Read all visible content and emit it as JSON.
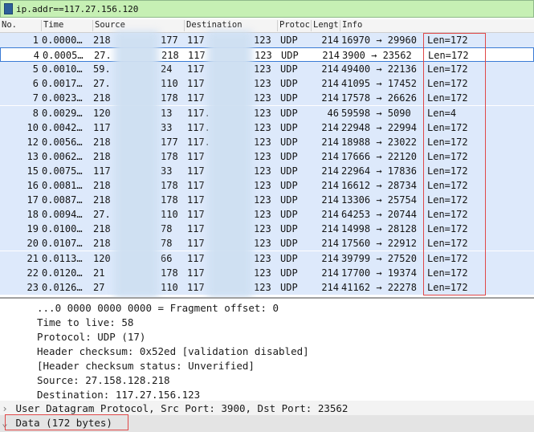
{
  "filter": {
    "text": "ip.addr==117.27.156.120"
  },
  "columns": [
    "No.",
    "Time",
    "Source",
    "Destination",
    "Protoc",
    "Lengt",
    "Info"
  ],
  "rows": [
    {
      "no": "1",
      "time": "0.0000…",
      "src_a": "218",
      "src_b": "177",
      "dst_a": "117",
      "dst_b": "123",
      "proto": "UDP",
      "len": "214",
      "info": "16970 → 29960",
      "lenval": "Len=172"
    },
    {
      "no": "4",
      "time": "0.0005…",
      "src_a": "27.",
      "src_b": "218",
      "dst_a": "117",
      "dst_b": "123",
      "proto": "UDP",
      "len": "214",
      "info": "3900 → 23562",
      "lenval": "Len=172"
    },
    {
      "no": "5",
      "time": "0.0010…",
      "src_a": "59.",
      "src_b": "24",
      "dst_a": "117",
      "dst_b": "123",
      "proto": "UDP",
      "len": "214",
      "info": "49400 → 22136",
      "lenval": "Len=172"
    },
    {
      "no": "6",
      "time": "0.0017…",
      "src_a": "27.",
      "src_b": "110",
      "dst_a": "117",
      "dst_b": "123",
      "proto": "UDP",
      "len": "214",
      "info": "41095 → 17452",
      "lenval": "Len=172"
    },
    {
      "no": "7",
      "time": "0.0023…",
      "src_a": "218",
      "src_b": "178",
      "dst_a": "117",
      "dst_b": "123",
      "proto": "UDP",
      "len": "214",
      "info": "17578 → 26626",
      "lenval": "Len=172"
    },
    {
      "no": "8",
      "time": "0.0029…",
      "src_a": "120",
      "src_b": "13",
      "dst_a": "117.",
      "dst_b": "123",
      "proto": "UDP",
      "len": "46",
      "info": "59598 → 5090",
      "lenval": "Len=4"
    },
    {
      "no": "10",
      "time": "0.0042…",
      "src_a": "117",
      "src_b": "33",
      "dst_a": "117.",
      "dst_b": "123",
      "proto": "UDP",
      "len": "214",
      "info": "22948 → 22994",
      "lenval": "Len=172"
    },
    {
      "no": "12",
      "time": "0.0056…",
      "src_a": "218",
      "src_b": "177",
      "dst_a": "117.",
      "dst_b": "123",
      "proto": "UDP",
      "len": "214",
      "info": "18988 → 23022",
      "lenval": "Len=172"
    },
    {
      "no": "13",
      "time": "0.0062…",
      "src_a": "218",
      "src_b": "178",
      "dst_a": "117",
      "dst_b": "123",
      "proto": "UDP",
      "len": "214",
      "info": "17666 → 22120",
      "lenval": "Len=172"
    },
    {
      "no": "15",
      "time": "0.0075…",
      "src_a": "117",
      "src_b": "33",
      "dst_a": "117",
      "dst_b": "123",
      "proto": "UDP",
      "len": "214",
      "info": "22964 → 17836",
      "lenval": "Len=172"
    },
    {
      "no": "16",
      "time": "0.0081…",
      "src_a": "218",
      "src_b": "178",
      "dst_a": "117",
      "dst_b": "123",
      "proto": "UDP",
      "len": "214",
      "info": "16612 → 28734",
      "lenval": "Len=172"
    },
    {
      "no": "17",
      "time": "0.0087…",
      "src_a": "218",
      "src_b": "178",
      "dst_a": "117",
      "dst_b": "123",
      "proto": "UDP",
      "len": "214",
      "info": "13306 → 25754",
      "lenval": "Len=172"
    },
    {
      "no": "18",
      "time": "0.0094…",
      "src_a": "27.",
      "src_b": "110",
      "dst_a": "117",
      "dst_b": "123",
      "proto": "UDP",
      "len": "214",
      "info": "64253 → 20744",
      "lenval": "Len=172"
    },
    {
      "no": "19",
      "time": "0.0100…",
      "src_a": "218",
      "src_b": "78",
      "dst_a": "117",
      "dst_b": "123",
      "proto": "UDP",
      "len": "214",
      "info": "14998 → 28128",
      "lenval": "Len=172"
    },
    {
      "no": "20",
      "time": "0.0107…",
      "src_a": "218",
      "src_b": "78",
      "dst_a": "117",
      "dst_b": "123",
      "proto": "UDP",
      "len": "214",
      "info": "17560 → 22912",
      "lenval": "Len=172"
    },
    {
      "no": "21",
      "time": "0.0113…",
      "src_a": "120",
      "src_b": "66",
      "dst_a": "117",
      "dst_b": "123",
      "proto": "UDP",
      "len": "214",
      "info": "39799 → 27520",
      "lenval": "Len=172"
    },
    {
      "no": "22",
      "time": "0.0120…",
      "src_a": "21",
      "src_b": "178",
      "dst_a": "117",
      "dst_b": "123",
      "proto": "UDP",
      "len": "214",
      "info": "17700 → 19374",
      "lenval": "Len=172"
    },
    {
      "no": "23",
      "time": "0.0126…",
      "src_a": "27",
      "src_b": "110",
      "dst_a": "117",
      "dst_b": "123",
      "proto": "UDP",
      "len": "214",
      "info": "41162 → 22278",
      "lenval": "Len=172"
    }
  ],
  "detail": {
    "fragment": "...0 0000 0000 0000 = Fragment offset: 0",
    "ttl": "Time to live: 58",
    "protocol": "Protocol: UDP (17)",
    "checksum": "Header checksum: 0x52ed [validation disabled]",
    "checksum_status": "[Header checksum status: Unverified]",
    "source": "Source: 27.158.128.218",
    "destination": "Destination: 117.27.156.123",
    "udp": "User Datagram Protocol, Src Port: 3900, Dst Port: 23562",
    "data": "Data (172 bytes)"
  },
  "colors": {
    "row_bg": "#dde9fb",
    "filter_bg": "#c6f0b4",
    "highlight": "#e04848",
    "selection": "#3a7bd5"
  }
}
